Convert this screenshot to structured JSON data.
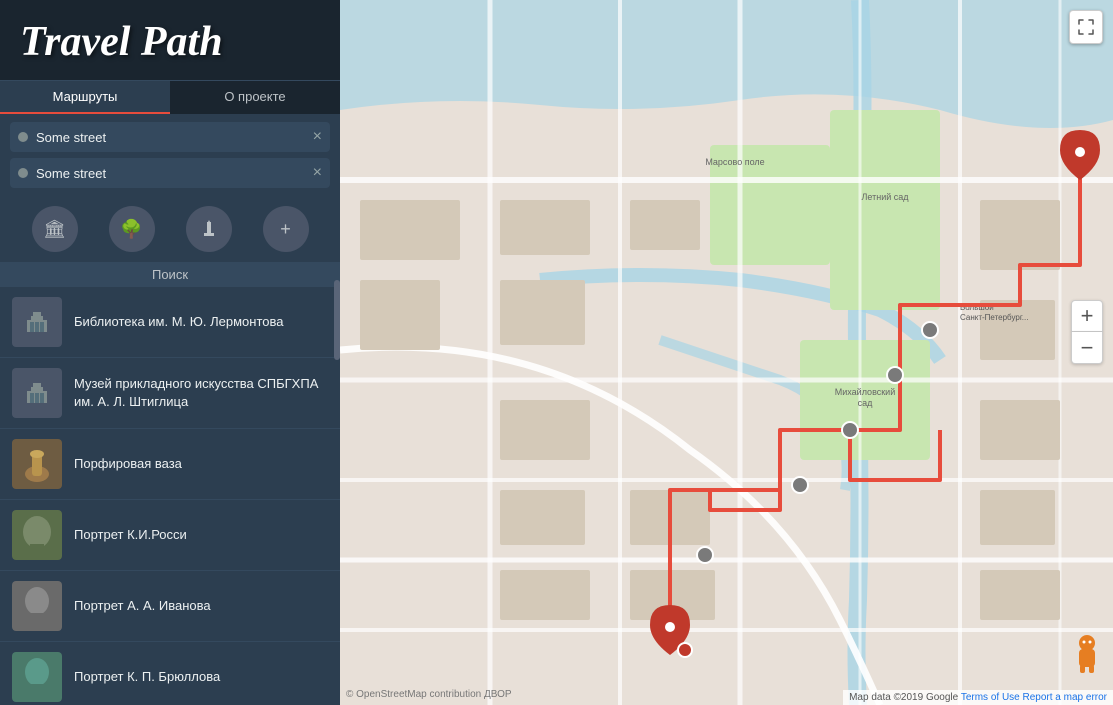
{
  "app": {
    "title": "Travel Path"
  },
  "tabs": [
    {
      "id": "routes",
      "label": "Маршруты",
      "active": true
    },
    {
      "id": "about",
      "label": "О проекте",
      "active": false
    }
  ],
  "route_inputs": [
    {
      "id": "start",
      "value": "Some street",
      "placeholder": "Some street"
    },
    {
      "id": "end",
      "value": "Some street",
      "placeholder": "Some street"
    }
  ],
  "category_icons": [
    {
      "id": "museum",
      "symbol": "🏛",
      "label": "museum-icon"
    },
    {
      "id": "nature",
      "symbol": "🌳",
      "label": "nature-icon"
    },
    {
      "id": "monument",
      "symbol": "↓",
      "label": "monument-icon"
    },
    {
      "id": "add",
      "symbol": "+",
      "label": "add-icon"
    }
  ],
  "search_label": "Поиск",
  "places": [
    {
      "id": 1,
      "name": "Библиотека им. М. Ю. Лермонтова",
      "thumb_type": "museum",
      "thumb_color": "#4a5568"
    },
    {
      "id": 2,
      "name": "Музей прикладного искусства СПБГХПА им. А. Л. Штиглица",
      "thumb_type": "museum",
      "thumb_color": "#4a5568"
    },
    {
      "id": 3,
      "name": "Порфировая ваза",
      "thumb_type": "photo",
      "thumb_color": "#8B7355"
    },
    {
      "id": 4,
      "name": "Портрет К.И.Росси",
      "thumb_type": "photo",
      "thumb_color": "#6B8E5E"
    },
    {
      "id": 5,
      "name": "Портрет А. А. Иванова",
      "thumb_type": "photo",
      "thumb_color": "#7A7A7A"
    },
    {
      "id": 6,
      "name": "Портрет К. П. Брюллова",
      "thumb_type": "photo",
      "thumb_color": "#5A8A7A"
    }
  ],
  "map": {
    "zoom_in": "+",
    "zoom_out": "−",
    "attribution": "Map data ©2019 Google",
    "terms": "Terms of Use",
    "report": "Report a map error",
    "logo": "© OpenStreetMap contribution ДВОР"
  },
  "colors": {
    "sidebar_bg": "#2c3e50",
    "sidebar_dark": "#1a252f",
    "accent": "#e74c3c",
    "route_line": "#e74c3c",
    "tab_active_bg": "#2c3e50",
    "tab_inactive_bg": "#1a252f"
  }
}
